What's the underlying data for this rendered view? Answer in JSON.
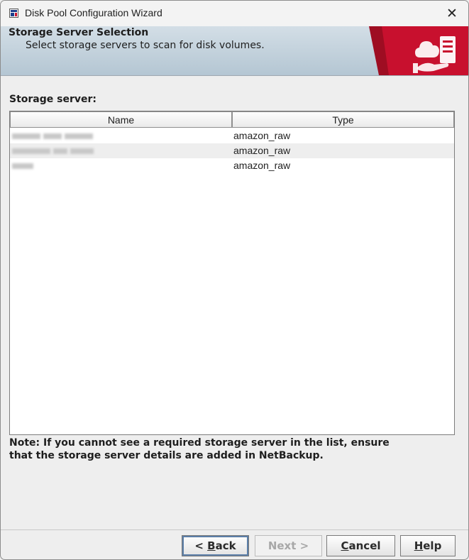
{
  "window": {
    "title": "Disk Pool Configuration Wizard",
    "close_glyph": "✕"
  },
  "banner": {
    "title": "Storage Server Selection",
    "subtitle": "Select storage servers to scan for disk volumes.",
    "accent_color": "#c8102e"
  },
  "storage_section": {
    "label": "Storage server:"
  },
  "table": {
    "columns": [
      "Name",
      "Type"
    ],
    "rows": [
      {
        "name": "",
        "type": "amazon_raw",
        "selected": false
      },
      {
        "name": "",
        "type": "amazon_raw",
        "selected": false
      },
      {
        "name": "",
        "type": "amazon_raw",
        "selected": false
      }
    ]
  },
  "note": {
    "line1": "Note: If you cannot see a required storage server in the list, ensure",
    "line2": "that the storage server details are added in NetBackup."
  },
  "buttons": {
    "back": {
      "prefix": "< ",
      "mnemonic": "B",
      "rest": "ack"
    },
    "next": {
      "label": "Next >",
      "enabled": false
    },
    "cancel": {
      "mnemonic": "C",
      "rest": "ancel"
    },
    "help": {
      "mnemonic": "H",
      "rest": "elp"
    }
  }
}
